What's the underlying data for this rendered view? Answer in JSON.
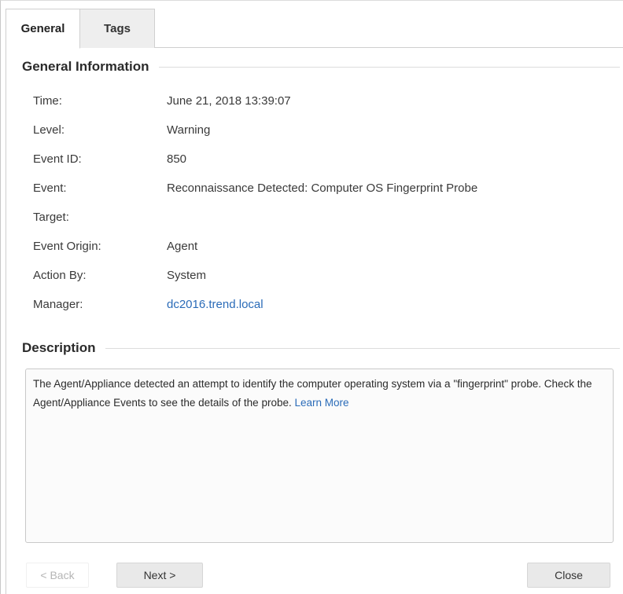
{
  "tabs": [
    {
      "label": "General",
      "active": true
    },
    {
      "label": "Tags",
      "active": false
    }
  ],
  "general_info": {
    "title": "General Information",
    "rows": [
      {
        "label": "Time:",
        "value": "June 21, 2018 13:39:07"
      },
      {
        "label": "Level:",
        "value": "Warning"
      },
      {
        "label": "Event ID:",
        "value": "850"
      },
      {
        "label": "Event:",
        "value": "Reconnaissance Detected: Computer OS Fingerprint Probe"
      },
      {
        "label": "Target:",
        "value": ""
      },
      {
        "label": "Event Origin:",
        "value": "Agent"
      },
      {
        "label": "Action By:",
        "value": "System"
      },
      {
        "label": "Manager:",
        "value": "dc2016.trend.local"
      }
    ]
  },
  "description": {
    "title": "Description",
    "text": "The Agent/Appliance detected an attempt to identify the computer operating system via a \"fingerprint\" probe. Check the Agent/Appliance Events to see the details of the probe.",
    "learn_more": "Learn More"
  },
  "buttons": {
    "back": "< Back",
    "next": "Next >",
    "close": "Close"
  },
  "colors": {
    "link": "#2a6bb8",
    "tab_inactive_bg": "#eeeeee",
    "button_bg": "#e9e9e9"
  }
}
